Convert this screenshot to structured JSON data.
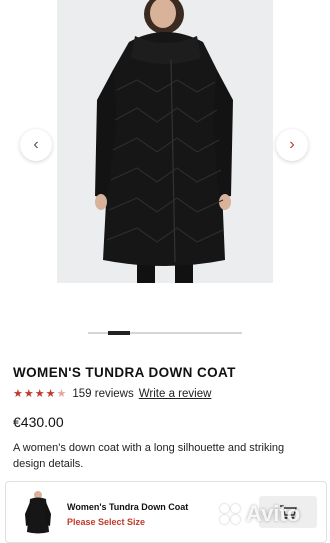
{
  "product": {
    "title": "WOMEN'S TUNDRA DOWN COAT",
    "rating_value": 4.5,
    "rating_max": 5,
    "review_count_text": "159 reviews",
    "write_review_label": "Write a review",
    "price": "€430.00",
    "description": "A women's down coat with a long silhouette and striking design details."
  },
  "gallery": {
    "prev_icon": "chevron-left-icon",
    "next_icon": "chevron-right-icon",
    "slide_progress": 0.28
  },
  "sticky_bar": {
    "name": "Women's Tundra Down Coat",
    "size_prompt": "Please Select Size",
    "cart_icon": "cart-icon"
  },
  "watermark": {
    "text": "Avito"
  },
  "colors": {
    "accent": "#c0392b",
    "photo_bg": "#ecedef",
    "coat": "#161616"
  }
}
